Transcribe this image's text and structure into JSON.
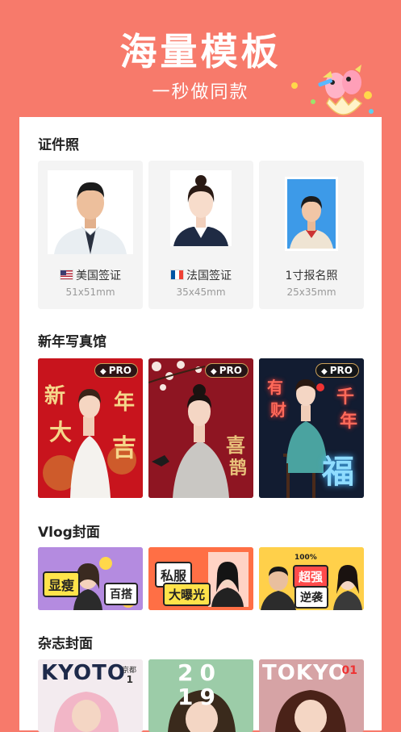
{
  "hero": {
    "title": "海量模板",
    "subtitle": "一秒做同款"
  },
  "sections": {
    "id_photo": {
      "title": "证件照",
      "items": [
        {
          "name": "美国签证",
          "size": "51x51mm",
          "flag": "us-flag-icon"
        },
        {
          "name": "法国签证",
          "size": "35x45mm",
          "flag": "fr-flag-icon"
        },
        {
          "name": "1寸报名照",
          "size": "25x35mm"
        }
      ]
    },
    "new_year": {
      "title": "新年写真馆",
      "badge": "PRO",
      "tile1": {
        "c1": "新",
        "c2": "年",
        "c3": "大",
        "c4": "吉"
      },
      "tile2": {
        "c1": "喜",
        "c2": "鹊"
      },
      "tile3": {
        "c1": "千",
        "c2": "年",
        "c3": "有",
        "c4": "财",
        "c5": "福"
      }
    },
    "vlog": {
      "title": "Vlog封面",
      "tile1": {
        "t1": "显瘦",
        "t2": "百搭"
      },
      "tile2": {
        "t1": "私服",
        "t2": "大曝光"
      },
      "tile3": {
        "t1": "超强",
        "t2": "逆袭",
        "t0": "100%"
      }
    },
    "magazine": {
      "title": "杂志封面",
      "tile1": {
        "title": "KYOTO",
        "side": "京都",
        "num": "1"
      },
      "tile2": {
        "title": "20",
        "title2": "19"
      },
      "tile3": {
        "title": "TOKYO",
        "num": "01"
      }
    }
  },
  "colors": {
    "background": "#f77a6b",
    "card": "#ffffff",
    "tile_bg": "#f4f4f4"
  }
}
